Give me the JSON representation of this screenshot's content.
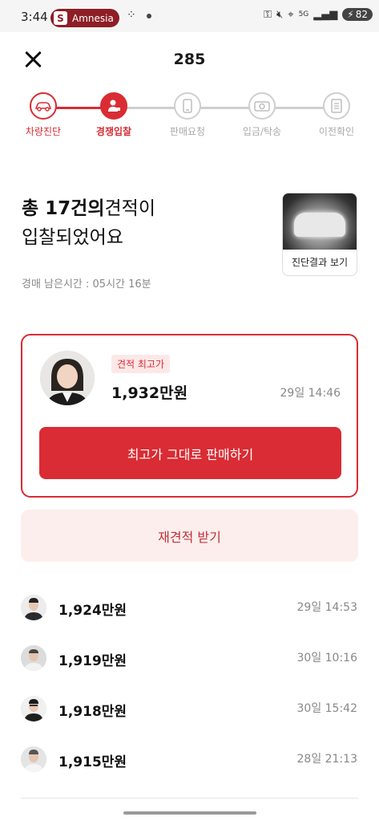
{
  "status_bar": {
    "time": "3:44",
    "notification_app": "Amnesia",
    "notification_letter": "S",
    "network": "5G",
    "battery": "82"
  },
  "header": {
    "title": "285"
  },
  "stepper": {
    "steps": [
      {
        "label": "차량진단",
        "state": "done",
        "icon": "car-icon"
      },
      {
        "label": "경쟁입찰",
        "state": "active",
        "icon": "bidder-icon"
      },
      {
        "label": "판매요청",
        "state": "pending",
        "icon": "phone-icon"
      },
      {
        "label": "입금/탁송",
        "state": "pending",
        "icon": "camera-icon"
      },
      {
        "label": "이전확인",
        "state": "pending",
        "icon": "document-icon"
      }
    ]
  },
  "summary": {
    "line1_prefix": "총 ",
    "line1_count": "17건의",
    "line1_suffix": "견적이",
    "line2": "입찰되었어요",
    "auction_time": "경매 남은시간 : 05시간 16분",
    "diagnosis_button": "진단결과 보기"
  },
  "top_bid": {
    "badge": "견적 최고가",
    "price": "1,932만원",
    "time": "29일 14:46",
    "sell_button": "최고가 그대로 판매하기"
  },
  "requote_button": "재견적 받기",
  "bids": [
    {
      "price": "1,924만원",
      "time": "29일 14:53"
    },
    {
      "price": "1,919만원",
      "time": "30일 10:16"
    },
    {
      "price": "1,918만원",
      "time": "30일 15:42"
    },
    {
      "price": "1,915만원",
      "time": "28일 21:13"
    }
  ],
  "colors": {
    "accent": "#d92c34",
    "accent_light": "#fdeeee",
    "muted": "#888888",
    "inactive": "#cfcfcf"
  }
}
